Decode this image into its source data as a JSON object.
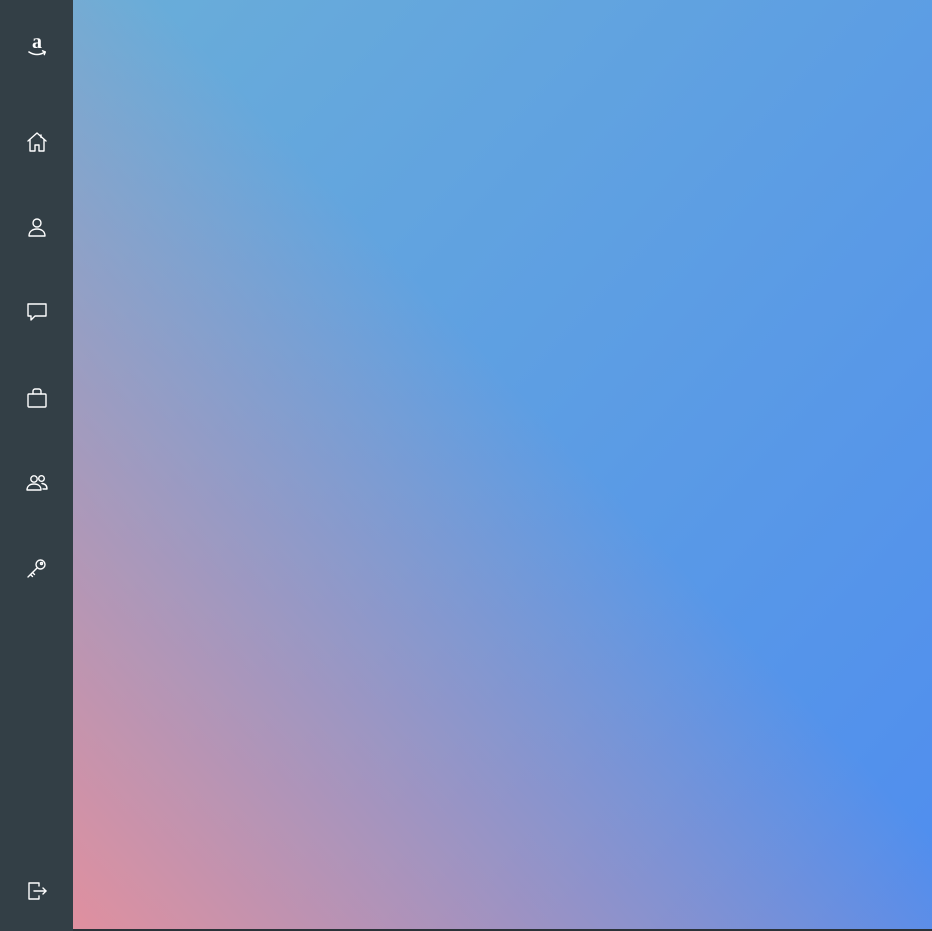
{
  "sidebar": {
    "logo": {
      "icon": "amazon-logo-icon"
    },
    "items": [
      {
        "name": "home",
        "icon": "home-icon"
      },
      {
        "name": "profile",
        "icon": "user-icon"
      },
      {
        "name": "messages",
        "icon": "chat-bubble-icon"
      },
      {
        "name": "jobs",
        "icon": "briefcase-icon"
      },
      {
        "name": "team",
        "icon": "users-icon"
      },
      {
        "name": "security",
        "icon": "key-icon"
      }
    ],
    "footer": {
      "name": "logout",
      "icon": "logout-icon"
    }
  },
  "main": {
    "background": {
      "from_top_left": "#6aaed8",
      "to_top_right": "#4f8def",
      "bottom_left": "#e0909f",
      "sidebar_color": "#333f46"
    }
  }
}
